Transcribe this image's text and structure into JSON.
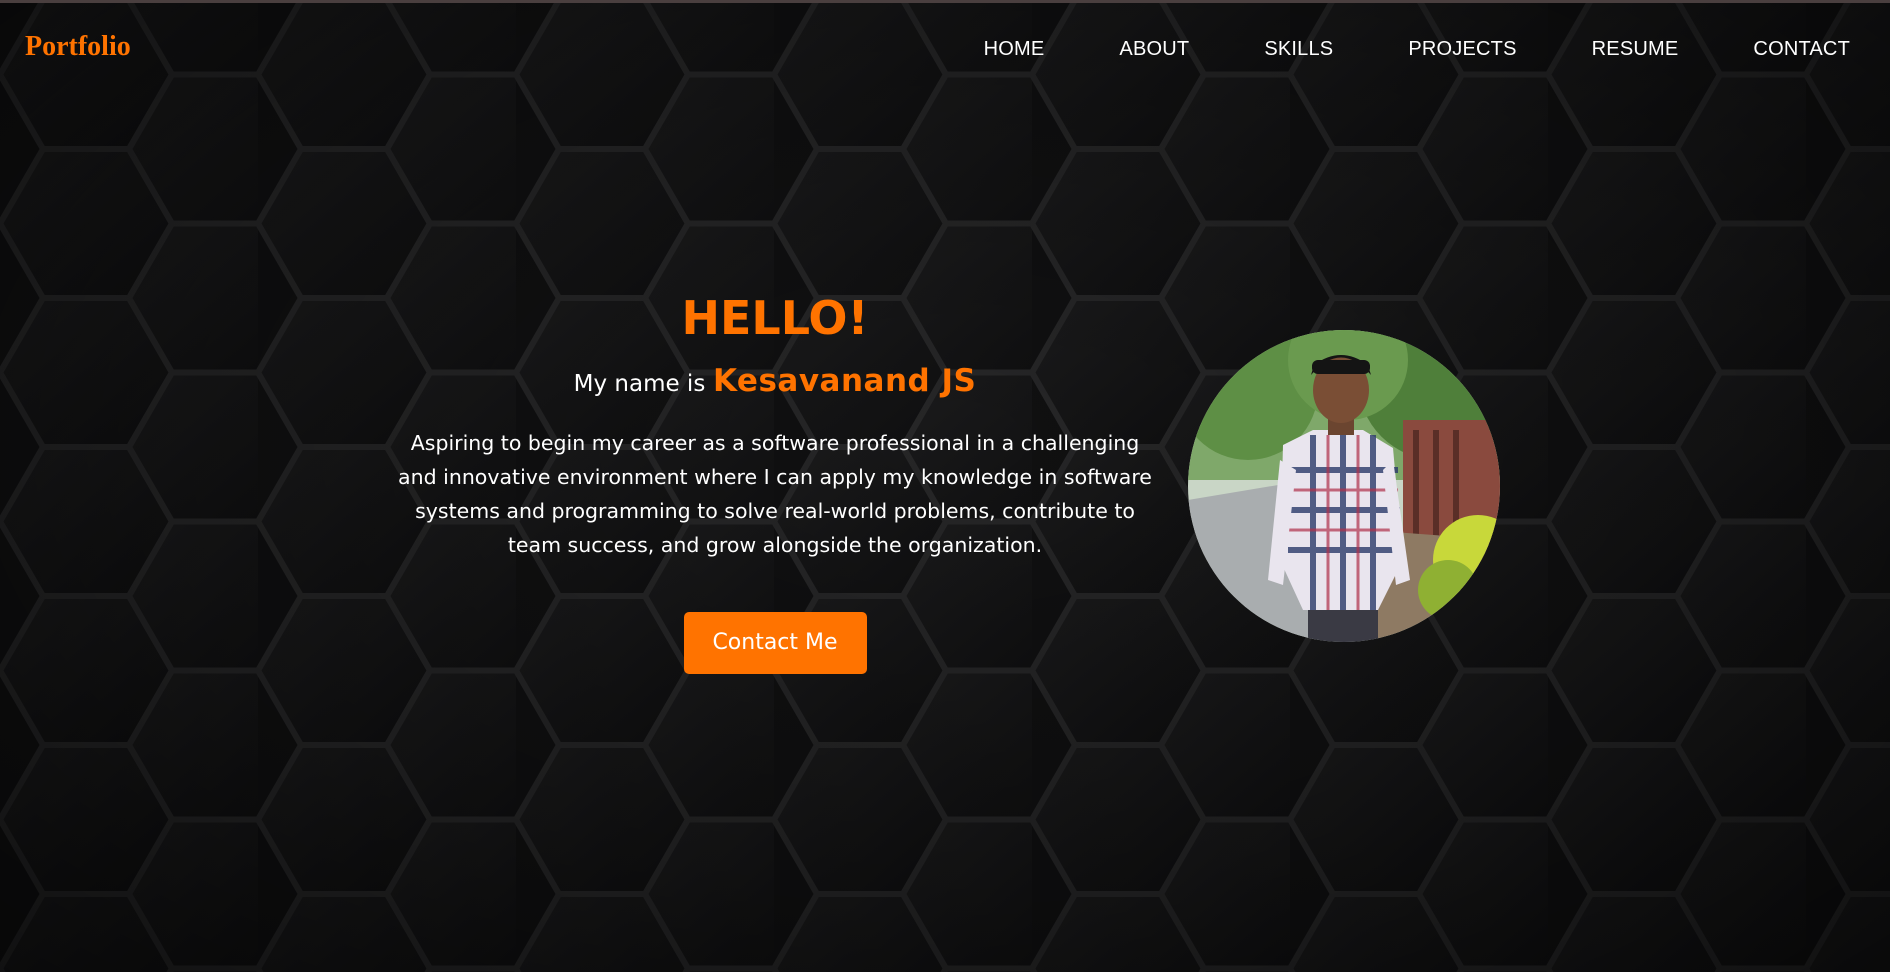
{
  "header": {
    "brand": "Portfolio",
    "nav": [
      {
        "label": "HOME"
      },
      {
        "label": "ABOUT"
      },
      {
        "label": "SKILLS"
      },
      {
        "label": "PROJECTS"
      },
      {
        "label": "RESUME"
      },
      {
        "label": "CONTACT"
      }
    ]
  },
  "hero": {
    "greeting": "HELLO!",
    "name_prefix": "My name is",
    "name": "Kesavanand JS",
    "bio": "Aspiring to begin my career as a software professional in a challenging and innovative environment where I can apply my knowledge in software systems and programming to solve real-world problems, contribute to team success, and grow alongside the organization.",
    "cta_label": "Contact Me"
  },
  "colors": {
    "accent": "#ff7300",
    "background": "#0f0f10",
    "text": "#ffffff"
  }
}
